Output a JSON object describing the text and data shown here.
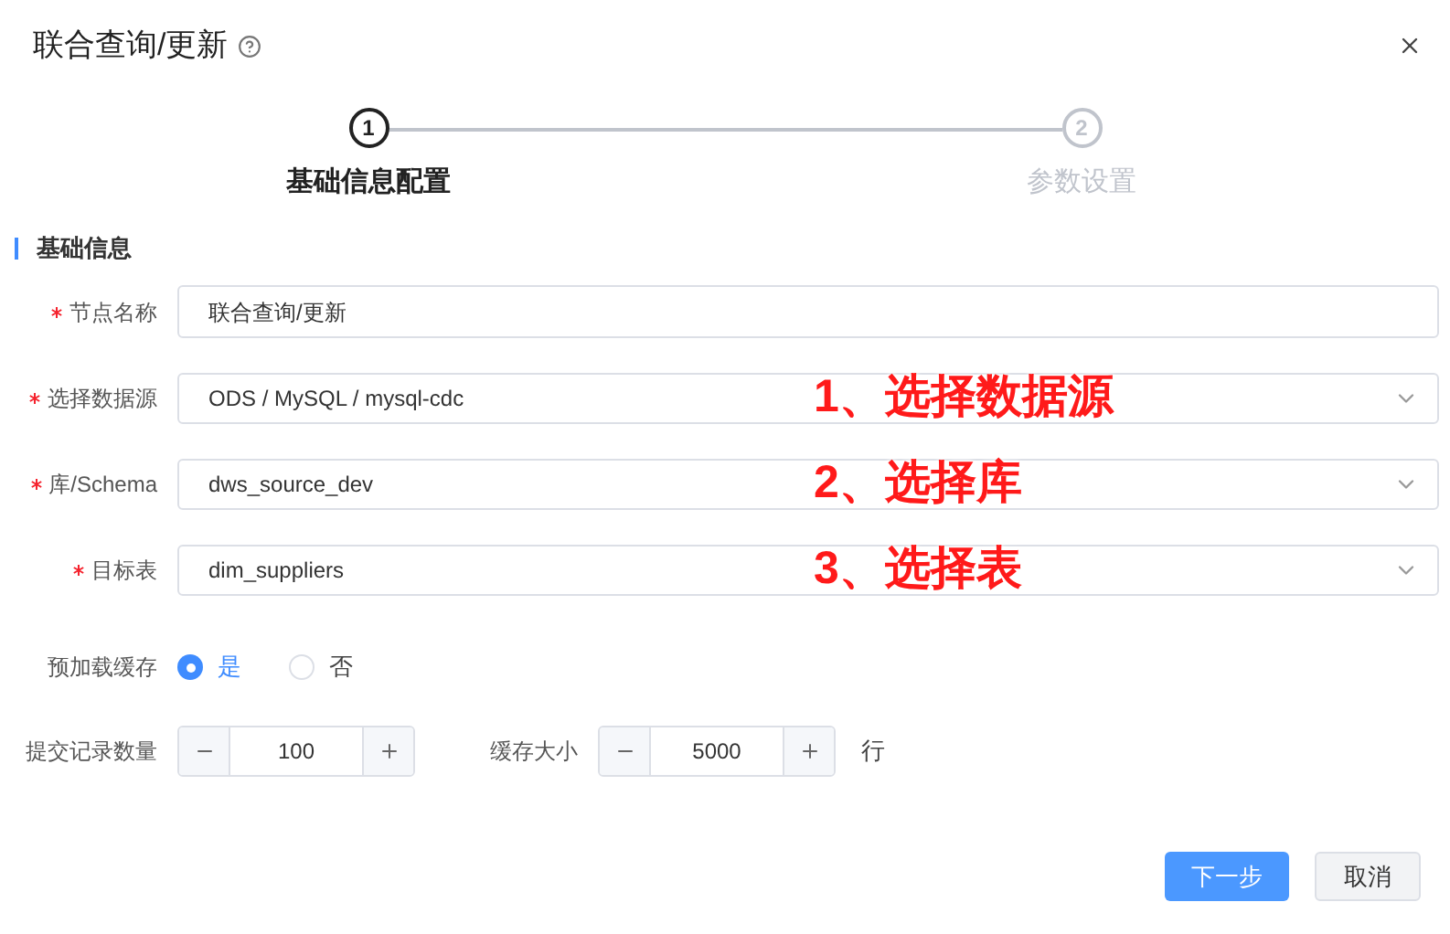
{
  "dialog": {
    "title": "联合查询/更新"
  },
  "steps": [
    {
      "number": "1",
      "label": "基础信息配置",
      "selected": true
    },
    {
      "number": "2",
      "label": "参数设置",
      "selected": false
    }
  ],
  "section": {
    "title": "基础信息"
  },
  "fields": [
    {
      "kind": "input",
      "label": "节点名称",
      "required": true,
      "value": "联合查询/更新"
    },
    {
      "kind": "select",
      "label": "选择数据源",
      "required": true,
      "value": "ODS / MySQL / mysql-cdc",
      "annotation": "1、选择数据源"
    },
    {
      "kind": "select",
      "label": "库/Schema",
      "required": true,
      "value": "dws_source_dev",
      "annotation": "2、选择库"
    },
    {
      "kind": "select",
      "label": "目标表",
      "required": true,
      "value": "dim_suppliers",
      "annotation": "3、选择表"
    },
    {
      "kind": "radio",
      "label": "预加载缓存",
      "required": false,
      "options": [
        {
          "label": "是",
          "selected": true
        },
        {
          "label": "否",
          "selected": false
        }
      ]
    }
  ],
  "steppers": [
    {
      "label": "提交记录数量",
      "value": "100"
    },
    {
      "label": "缓存大小",
      "value": "5000",
      "unit": "行"
    }
  ],
  "buttons": [
    {
      "label": "下一步",
      "kind": "primary"
    },
    {
      "label": "取消",
      "kind": "default"
    }
  ]
}
